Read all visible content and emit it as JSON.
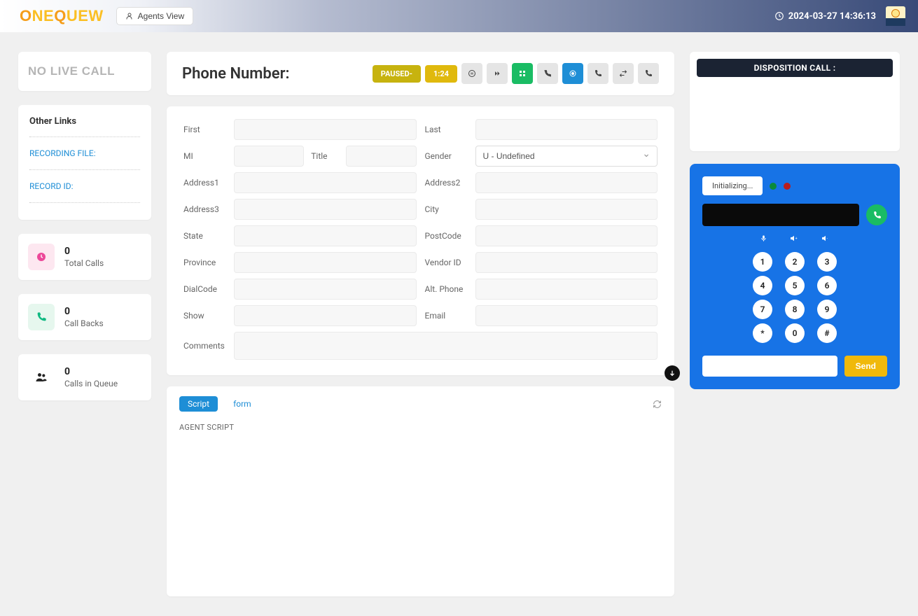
{
  "header": {
    "logo_part1": "O",
    "logo_part2": "NE",
    "logo_part3": "Q",
    "logo_part4": "UEW",
    "agents_view": "Agents View",
    "datetime": "2024-03-27 14:36:13"
  },
  "sidebar": {
    "no_live_call": "NO LIVE CALL",
    "other_links": "Other Links",
    "recording_file": "RECORDING FILE:",
    "record_id": "RECORD ID:",
    "stats": [
      {
        "value": "0",
        "label": "Total Calls"
      },
      {
        "value": "0",
        "label": "Call Backs"
      },
      {
        "value": "0",
        "label": "Calls in Queue"
      }
    ]
  },
  "main": {
    "title": "Phone Number:",
    "paused": "PAUSED-",
    "timer": "1:24",
    "form": {
      "first": "First",
      "last": "Last",
      "mi": "MI",
      "title": "Title",
      "gender": "Gender",
      "gender_value": "U - Undefined",
      "address1": "Address1",
      "address2": "Address2",
      "address3": "Address3",
      "city": "City",
      "state": "State",
      "postcode": "PostCode",
      "province": "Province",
      "vendor_id": "Vendor ID",
      "dialcode": "DialCode",
      "alt_phone": "Alt. Phone",
      "show": "Show",
      "email": "Email",
      "comments": "Comments"
    },
    "tabs": {
      "script": "Script",
      "form": "form"
    },
    "agent_script": "AGENT SCRIPT"
  },
  "right": {
    "disposition": "DISPOSITION CALL :",
    "initializing": "Initializing...",
    "send": "Send",
    "keys": [
      "1",
      "2",
      "3",
      "4",
      "5",
      "6",
      "7",
      "8",
      "9",
      "*",
      "0",
      "#"
    ]
  }
}
